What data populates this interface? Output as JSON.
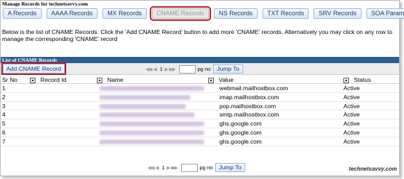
{
  "page_title": "Manage Records for technetsavvy.com",
  "tabs": [
    {
      "label": "A Records",
      "active": false
    },
    {
      "label": "AAAA Records",
      "active": false
    },
    {
      "label": "MX Records",
      "active": false
    },
    {
      "label": "CNAME Records",
      "active": true
    },
    {
      "label": "NS Records",
      "active": false
    },
    {
      "label": "TXT Records",
      "active": false
    },
    {
      "label": "SRV Records",
      "active": false
    },
    {
      "label": "SOA Parameters",
      "active": false
    }
  ],
  "description": "Below is the list of CNAME Records. Click the 'Add CNAME Record' button to add more 'CNAME' records. Alternatively you may click on any row to manage the corresponding 'CNAME' record",
  "list_title": "List of CNAME Records",
  "add_button_label": "Add CNAME Record",
  "pager": {
    "current_page": "1",
    "pg_label": "pg no",
    "jump_label": "Jump To"
  },
  "table": {
    "columns": [
      "Sr No",
      "Record Id",
      "Name",
      "Value",
      "Status"
    ],
    "rows": [
      {
        "sr": "1",
        "value": "webmail.mailhostbox.com",
        "status": "Active"
      },
      {
        "sr": "2",
        "value": "imap.mailhostbox.com",
        "status": "Active"
      },
      {
        "sr": "3",
        "value": "pop.mailhostbox.com",
        "status": "Active"
      },
      {
        "sr": "4",
        "value": "smtp.mailhostbox.com",
        "status": "Active"
      },
      {
        "sr": "5",
        "value": "ghs.google.com",
        "status": "Active"
      },
      {
        "sr": "6",
        "value": "ghs.google.com",
        "status": "Active"
      },
      {
        "sr": "7",
        "value": "ghs.google.com",
        "status": "Active"
      }
    ]
  },
  "watermark": "technetsavvy.com",
  "colors": {
    "header_bar": "#2a5f94",
    "highlight": "#b01c2a",
    "button_text": "#1a3a6b"
  }
}
